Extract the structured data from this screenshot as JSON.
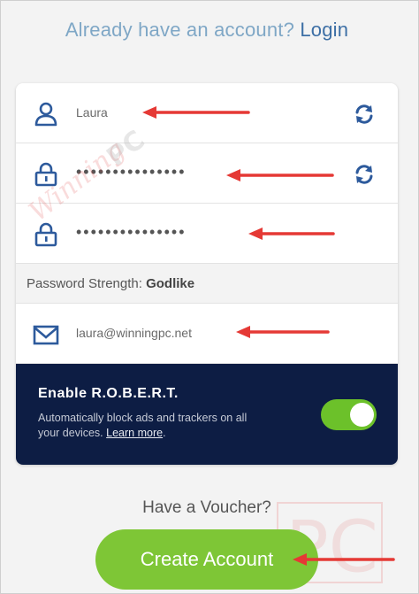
{
  "header": {
    "prompt": "Already have an account?",
    "login_label": "Login"
  },
  "form": {
    "username_value": "Laura",
    "password_value": "•••••••••••••••",
    "confirm_password_value": "•••••••••••••••",
    "strength_label": "Password Strength:",
    "strength_value": "Godlike",
    "email_value": "laura@winningpc.net"
  },
  "robert": {
    "title": "Enable R.O.B.E.R.T.",
    "description": "Automatically block ads and trackers on all your devices.",
    "learn_more": "Learn more",
    "enabled": true
  },
  "voucher_label": "Have a Voucher?",
  "create_button_label": "Create Account",
  "watermark": {
    "text": "WinningPC",
    "logo_text": "PC"
  },
  "colors": {
    "accent_blue": "#3d6fa5",
    "dark_panel": "#0d1d44",
    "green": "#7ec636",
    "arrow_red": "#e53935"
  },
  "icons": {
    "username": "user-icon",
    "password": "lock-icon",
    "email": "mail-icon",
    "regenerate": "refresh-icon"
  }
}
